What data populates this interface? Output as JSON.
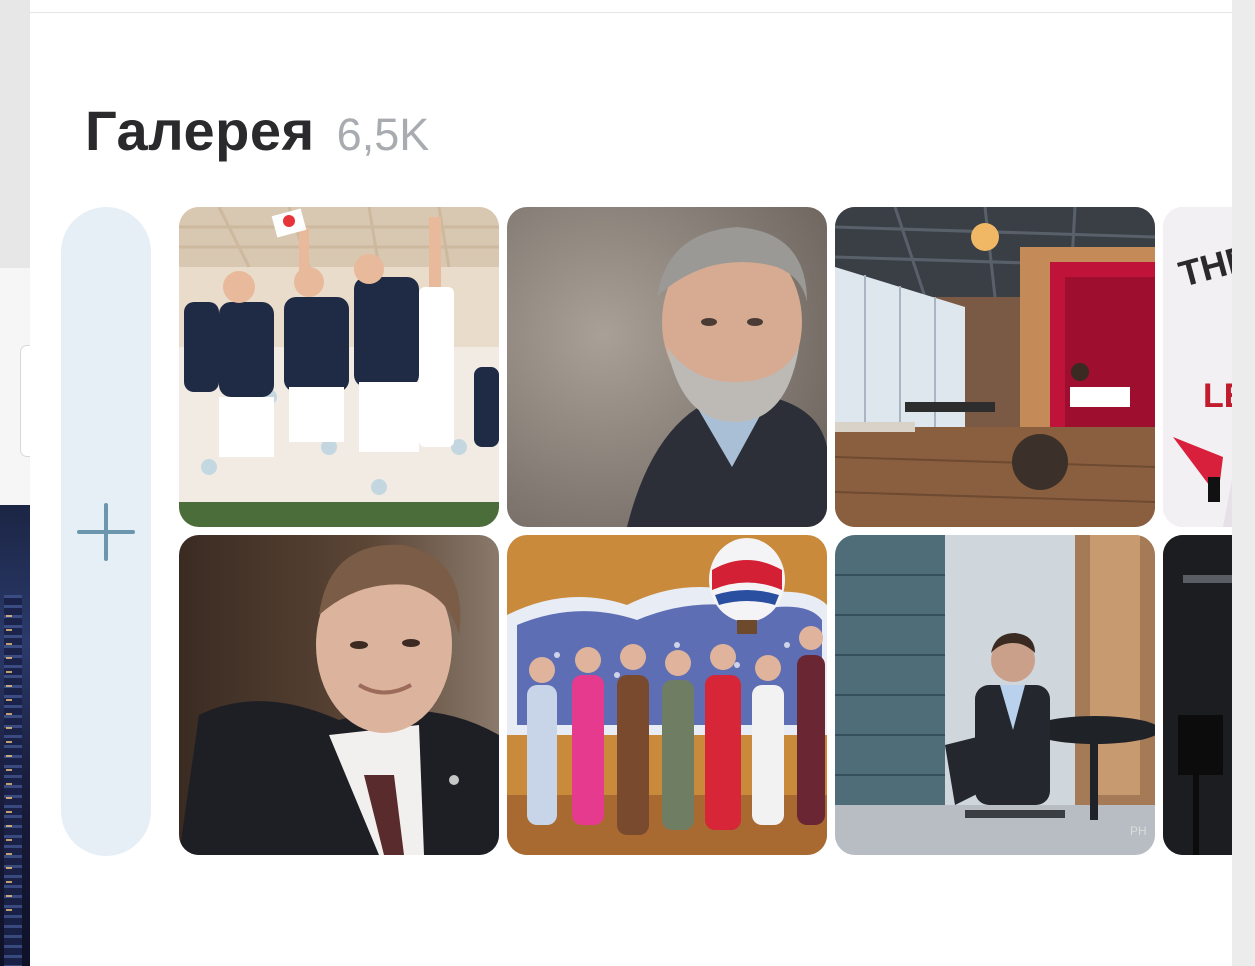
{
  "gallery": {
    "title": "Галерея",
    "count": "6,5K",
    "add_icon": "plus-icon",
    "photos": [
      {
        "subject": "team-celebration-photo"
      },
      {
        "subject": "portrait-gray-haired-man-photo"
      },
      {
        "subject": "office-interior-photo"
      },
      {
        "subject": "event-banner-photo"
      },
      {
        "subject": "portrait-man-in-suit-photo"
      },
      {
        "subject": "group-women-with-map-photo"
      },
      {
        "subject": "businessman-in-office-photo"
      },
      {
        "subject": "dark-studio-photo"
      }
    ]
  },
  "colors": {
    "accent": "#6b96ad",
    "add_tile_bg": "#e6eff6",
    "title": "#2a2a2c",
    "count": "#a8abb0"
  }
}
